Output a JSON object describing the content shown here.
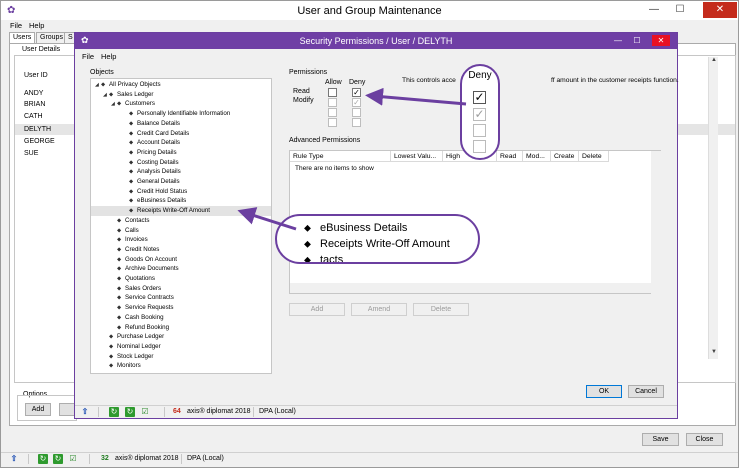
{
  "outer": {
    "title": "User and Group Maintenance",
    "menu": [
      "File",
      "Help"
    ],
    "tabs": [
      "Users",
      "Groups",
      "S"
    ],
    "user_details_label": "User Details",
    "user_id_header": "User ID",
    "users": [
      "ANDY",
      "BRIAN",
      "CATH",
      "DELYTH",
      "GEORGE",
      "SUE"
    ],
    "selected_user": "DELYTH",
    "options_label": "Options",
    "add_label": "Add",
    "save_label": "Save",
    "close_label": "Close",
    "status": {
      "number": "32",
      "product": "axis® diplomat 2018",
      "instance": "DPA (Local)"
    }
  },
  "inner": {
    "title": "Security Permissions / User / DELYTH",
    "menu": [
      "File",
      "Help"
    ],
    "objects_label": "Objects",
    "tree": [
      {
        "label": "All Privacy Objects",
        "level": 0,
        "exp": true
      },
      {
        "label": "Sales Ledger",
        "level": 1,
        "exp": true
      },
      {
        "label": "Customers",
        "level": 2,
        "exp": true
      },
      {
        "label": "Personally Identifiable Information",
        "level": 3
      },
      {
        "label": "Balance Details",
        "level": 3
      },
      {
        "label": "Credit Card Details",
        "level": 3
      },
      {
        "label": "Account Details",
        "level": 3
      },
      {
        "label": "Pricing Details",
        "level": 3
      },
      {
        "label": "Costing Details",
        "level": 3
      },
      {
        "label": "Analysis Details",
        "level": 3
      },
      {
        "label": "General Details",
        "level": 3
      },
      {
        "label": "Credit Hold Status",
        "level": 3
      },
      {
        "label": "eBusiness Details",
        "level": 3
      },
      {
        "label": "Receipts Write-Off Amount",
        "level": 3,
        "selected": true
      },
      {
        "label": "Contacts",
        "level": 2
      },
      {
        "label": "Calls",
        "level": 2
      },
      {
        "label": "Invoices",
        "level": 2
      },
      {
        "label": "Credit Notes",
        "level": 2
      },
      {
        "label": "Goods On Account",
        "level": 2
      },
      {
        "label": "Archive Documents",
        "level": 2
      },
      {
        "label": "Quotations",
        "level": 2
      },
      {
        "label": "Sales Orders",
        "level": 2
      },
      {
        "label": "Service Contracts",
        "level": 2
      },
      {
        "label": "Service Requests",
        "level": 2
      },
      {
        "label": "Cash Booking",
        "level": 2
      },
      {
        "label": "Refund Booking",
        "level": 2
      },
      {
        "label": "Purchase Ledger",
        "level": 1
      },
      {
        "label": "Nominal Ledger",
        "level": 1
      },
      {
        "label": "Stock Ledger",
        "level": 1
      },
      {
        "label": "Monitors",
        "level": 1
      }
    ],
    "permissions_label": "Permissions",
    "allow_header": "Allow",
    "deny_header": "Deny",
    "read_label": "Read",
    "modify_label": "Modify",
    "description": "This controls acce",
    "description_tail": "ff amount in the customer receipts function.",
    "advanced_label": "Advanced Permissions",
    "adv_columns": [
      "Rule Type",
      "Lowest Valu...",
      "High",
      "Read",
      "Mod...",
      "Create",
      "Delete"
    ],
    "adv_empty": "There are no items to show",
    "add_label": "Add",
    "amend_label": "Amend",
    "delete_label": "Delete",
    "ok_label": "OK",
    "cancel_label": "Cancel",
    "status": {
      "number": "64",
      "product": "axis® diplomat 2018",
      "instance": "DPA (Local)"
    }
  },
  "callouts": {
    "deny_title": "Deny",
    "zoom_rows": [
      "eBusiness Details",
      "Receipts Write-Off Amount",
      "tacts"
    ]
  },
  "colors": {
    "accent": "#6b3fa0",
    "arrow": "#6b3fa0"
  }
}
